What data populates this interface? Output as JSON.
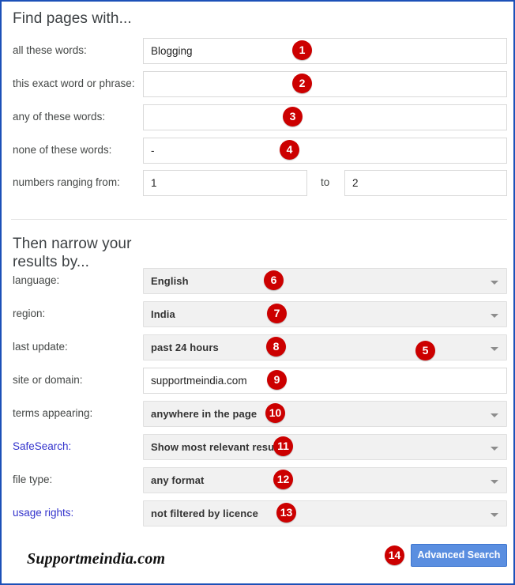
{
  "window": {
    "border_color": "#1c50b8"
  },
  "sections": {
    "find": {
      "title": "Find pages with..."
    },
    "narrow": {
      "title": "Then narrow your\nresults by..."
    }
  },
  "find_rows": [
    {
      "label": "all these words:",
      "value": "Blogging",
      "type": "text",
      "badge": "1"
    },
    {
      "label": "this exact word or phrase:",
      "value": "",
      "type": "text",
      "badge": "2"
    },
    {
      "label": "any of these words:",
      "value": "",
      "type": "text",
      "badge": "3"
    },
    {
      "label": "none of these words:",
      "value": "-",
      "type": "text",
      "badge": "4"
    }
  ],
  "numbers_row": {
    "label": "numbers ranging from:",
    "from_value": "1",
    "to_label": "to",
    "to_value": "2",
    "badge": "5"
  },
  "narrow_rows": [
    {
      "label": "language:",
      "value": "English",
      "type": "select",
      "badge": "6",
      "link": false
    },
    {
      "label": "region:",
      "value": "India",
      "type": "select",
      "badge": "7",
      "link": false
    },
    {
      "label": "last update:",
      "value": "past 24 hours",
      "type": "select",
      "badge": "8",
      "link": false
    },
    {
      "label": "site or domain:",
      "value": "supportmeindia.com",
      "type": "text",
      "badge": "9",
      "link": false
    },
    {
      "label": "terms appearing:",
      "value": "anywhere in the page",
      "type": "select",
      "badge": "10",
      "link": false
    },
    {
      "label": "SafeSearch:",
      "value": "Show most relevant results",
      "type": "select",
      "badge": "11",
      "link": true
    },
    {
      "label": "file type:",
      "value": "any format",
      "type": "select",
      "badge": "12",
      "link": false
    },
    {
      "label": "usage rights:",
      "value": "not filtered by licence",
      "type": "select",
      "badge": "13",
      "link": true
    }
  ],
  "footer": {
    "logo": "Supportmeindia.com",
    "button_label": "Advanced Search",
    "button_badge": "14",
    "button_color": "#5a8ee0"
  },
  "colors": {
    "badge_red": "#cc0000",
    "link_blue": "#3333cc",
    "border_blue": "#1c50b8",
    "select_bg": "#f1f1f1"
  }
}
